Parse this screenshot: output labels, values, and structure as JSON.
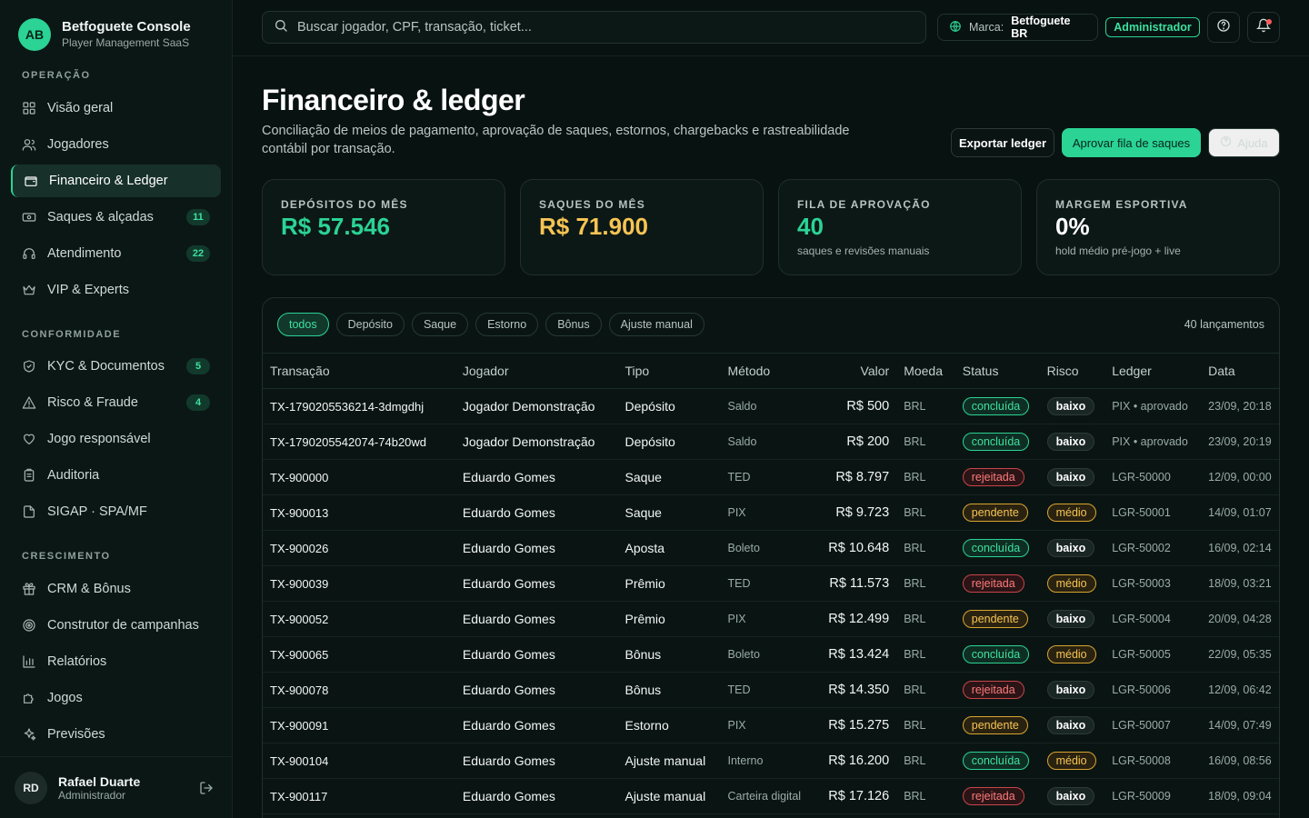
{
  "brand": {
    "initials": "AB",
    "title": "Betfoguete Console",
    "subtitle": "Player Management SaaS"
  },
  "sidebar": {
    "sections": [
      {
        "label": "OPERAÇÃO",
        "items": [
          {
            "label": "Visão geral",
            "icon": "grid-icon",
            "badge": ""
          },
          {
            "label": "Jogadores",
            "icon": "users-icon",
            "badge": ""
          },
          {
            "label": "Financeiro & Ledger",
            "icon": "wallet-icon",
            "badge": "",
            "active": true
          },
          {
            "label": "Saques & alçadas",
            "icon": "banknote-icon",
            "badge": "11"
          },
          {
            "label": "Atendimento",
            "icon": "headset-icon",
            "badge": "22"
          },
          {
            "label": "VIP & Experts",
            "icon": "crown-icon",
            "badge": ""
          }
        ]
      },
      {
        "label": "CONFORMIDADE",
        "items": [
          {
            "label": "KYC & Documentos",
            "icon": "shield-icon",
            "badge": "5"
          },
          {
            "label": "Risco & Fraude",
            "icon": "alert-triangle-icon",
            "badge": "4"
          },
          {
            "label": "Jogo responsável",
            "icon": "heart-hand-icon",
            "badge": ""
          },
          {
            "label": "Auditoria",
            "icon": "clipboard-icon",
            "badge": ""
          },
          {
            "label": "SIGAP · SPA/MF",
            "icon": "file-icon",
            "badge": ""
          }
        ]
      },
      {
        "label": "CRESCIMENTO",
        "items": [
          {
            "label": "CRM & Bônus",
            "icon": "gift-icon",
            "badge": ""
          },
          {
            "label": "Construtor de campanhas",
            "icon": "target-icon",
            "badge": ""
          },
          {
            "label": "Relatórios",
            "icon": "bar-chart-icon",
            "badge": ""
          },
          {
            "label": "Jogos",
            "icon": "puzzle-icon",
            "badge": ""
          },
          {
            "label": "Previsões",
            "icon": "sparkles-icon",
            "badge": ""
          }
        ]
      }
    ]
  },
  "user": {
    "initials": "RD",
    "name": "Rafael Duarte",
    "role": "Administrador"
  },
  "topbar": {
    "search_placeholder": "Buscar jogador, CPF, transação, ticket...",
    "brand_label": "Marca:",
    "brand_value": "Betfoguete BR",
    "role": "Administrador"
  },
  "header": {
    "title": "Financeiro & ledger",
    "description": "Conciliação de meios de pagamento, aprovação de saques, estornos, chargebacks e rastreabilidade contábil por transação.",
    "export_label": "Exportar ledger",
    "approve_label": "Aprovar fila de saques",
    "help_label": "Ajuda"
  },
  "kpis": [
    {
      "label": "DEPÓSITOS DO MÊS",
      "value": "R$ 57.546",
      "sub": "",
      "color": "#2bd395"
    },
    {
      "label": "SAQUES DO MÊS",
      "value": "R$ 71.900",
      "sub": "",
      "color": "#f6c453"
    },
    {
      "label": "FILA DE APROVAÇÃO",
      "value": "40",
      "sub": "saques e revisões manuais",
      "color": "#2bd395"
    },
    {
      "label": "MARGEM ESPORTIVA",
      "value": "0%",
      "sub": "hold médio pré-jogo + live",
      "color": "#ffffff"
    }
  ],
  "filters": [
    "todos",
    "Depósito",
    "Saque",
    "Estorno",
    "Bônus",
    "Ajuste manual"
  ],
  "active_filter": "todos",
  "count_label": "40 lançamentos",
  "columns": [
    "Transação",
    "Jogador",
    "Tipo",
    "Método",
    "Valor",
    "Moeda",
    "Status",
    "Risco",
    "Ledger",
    "Data"
  ],
  "rows": [
    {
      "tx": "TX-1790205536214-3dmgdhj",
      "player": "Jogador Demonstração",
      "type": "Depósito",
      "method": "Saldo",
      "value": "R$ 500",
      "currency": "BRL",
      "status": "concluída",
      "status_key": "concluida",
      "risk": "baixo",
      "risk_key": "baixo",
      "ledger": "PIX • aprovado",
      "date": "23/09, 20:18"
    },
    {
      "tx": "TX-1790205542074-74b20wd",
      "player": "Jogador Demonstração",
      "type": "Depósito",
      "method": "Saldo",
      "value": "R$ 200",
      "currency": "BRL",
      "status": "concluída",
      "status_key": "concluida",
      "risk": "baixo",
      "risk_key": "baixo",
      "ledger": "PIX • aprovado",
      "date": "23/09, 20:19"
    },
    {
      "tx": "TX-900000",
      "player": "Eduardo Gomes",
      "type": "Saque",
      "method": "TED",
      "value": "R$ 8.797",
      "currency": "BRL",
      "status": "rejeitada",
      "status_key": "rejeitada",
      "risk": "baixo",
      "risk_key": "baixo",
      "ledger": "LGR-50000",
      "date": "12/09, 00:00"
    },
    {
      "tx": "TX-900013",
      "player": "Eduardo Gomes",
      "type": "Saque",
      "method": "PIX",
      "value": "R$ 9.723",
      "currency": "BRL",
      "status": "pendente",
      "status_key": "pendente",
      "risk": "médio",
      "risk_key": "medio",
      "ledger": "LGR-50001",
      "date": "14/09, 01:07"
    },
    {
      "tx": "TX-900026",
      "player": "Eduardo Gomes",
      "type": "Aposta",
      "method": "Boleto",
      "value": "R$ 10.648",
      "currency": "BRL",
      "status": "concluída",
      "status_key": "concluida",
      "risk": "baixo",
      "risk_key": "baixo",
      "ledger": "LGR-50002",
      "date": "16/09, 02:14"
    },
    {
      "tx": "TX-900039",
      "player": "Eduardo Gomes",
      "type": "Prêmio",
      "method": "TED",
      "value": "R$ 11.573",
      "currency": "BRL",
      "status": "rejeitada",
      "status_key": "rejeitada",
      "risk": "médio",
      "risk_key": "medio",
      "ledger": "LGR-50003",
      "date": "18/09, 03:21"
    },
    {
      "tx": "TX-900052",
      "player": "Eduardo Gomes",
      "type": "Prêmio",
      "method": "PIX",
      "value": "R$ 12.499",
      "currency": "BRL",
      "status": "pendente",
      "status_key": "pendente",
      "risk": "baixo",
      "risk_key": "baixo",
      "ledger": "LGR-50004",
      "date": "20/09, 04:28"
    },
    {
      "tx": "TX-900065",
      "player": "Eduardo Gomes",
      "type": "Bônus",
      "method": "Boleto",
      "value": "R$ 13.424",
      "currency": "BRL",
      "status": "concluída",
      "status_key": "concluida",
      "risk": "médio",
      "risk_key": "medio",
      "ledger": "LGR-50005",
      "date": "22/09, 05:35"
    },
    {
      "tx": "TX-900078",
      "player": "Eduardo Gomes",
      "type": "Bônus",
      "method": "TED",
      "value": "R$ 14.350",
      "currency": "BRL",
      "status": "rejeitada",
      "status_key": "rejeitada",
      "risk": "baixo",
      "risk_key": "baixo",
      "ledger": "LGR-50006",
      "date": "12/09, 06:42"
    },
    {
      "tx": "TX-900091",
      "player": "Eduardo Gomes",
      "type": "Estorno",
      "method": "PIX",
      "value": "R$ 15.275",
      "currency": "BRL",
      "status": "pendente",
      "status_key": "pendente",
      "risk": "baixo",
      "risk_key": "baixo",
      "ledger": "LGR-50007",
      "date": "14/09, 07:49"
    },
    {
      "tx": "TX-900104",
      "player": "Eduardo Gomes",
      "type": "Ajuste manual",
      "method": "Interno",
      "value": "R$ 16.200",
      "currency": "BRL",
      "status": "concluída",
      "status_key": "concluida",
      "risk": "médio",
      "risk_key": "medio",
      "ledger": "LGR-50008",
      "date": "16/09, 08:56"
    },
    {
      "tx": "TX-900117",
      "player": "Eduardo Gomes",
      "type": "Ajuste manual",
      "method": "Carteira digital",
      "value": "R$ 17.126",
      "currency": "BRL",
      "status": "rejeitada",
      "status_key": "rejeitada",
      "risk": "baixo",
      "risk_key": "baixo",
      "ledger": "LGR-50009",
      "date": "18/09, 09:04"
    }
  ]
}
